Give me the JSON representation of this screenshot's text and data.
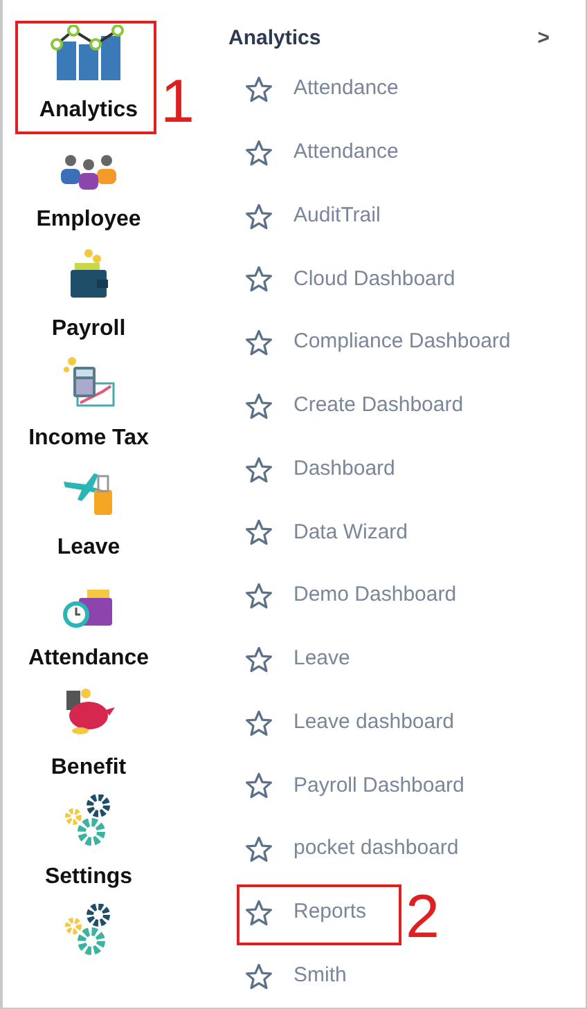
{
  "modules": [
    {
      "kind": "full",
      "label": "Analytics",
      "callout": "1"
    },
    {
      "kind": "full",
      "label": "Employee"
    },
    {
      "kind": "full",
      "label": "Payroll"
    },
    {
      "kind": "full",
      "label": "Income Tax"
    },
    {
      "kind": "full",
      "label": "Leave"
    },
    {
      "kind": "full",
      "label": "Attendance"
    },
    {
      "kind": "full",
      "label": "Benefit"
    },
    {
      "kind": "full",
      "label": "Settings"
    },
    {
      "kind": "icon-only"
    }
  ],
  "submenu": {
    "title": "Analytics",
    "chevron": ">",
    "items": [
      {
        "label": "Attendance"
      },
      {
        "label": "Attendance"
      },
      {
        "label": "AuditTrail"
      },
      {
        "label": "Cloud Dashboard"
      },
      {
        "label": "Compliance Dashboard"
      },
      {
        "label": "Create Dashboard"
      },
      {
        "label": "Dashboard"
      },
      {
        "label": "Data Wizard"
      },
      {
        "label": "Demo Dashboard"
      },
      {
        "label": "Leave"
      },
      {
        "label": "Leave dashboard"
      },
      {
        "label": "Payroll Dashboard"
      },
      {
        "label": "pocket dashboard"
      },
      {
        "label": "Reports",
        "callout": "2"
      },
      {
        "label": "Smith"
      }
    ]
  }
}
